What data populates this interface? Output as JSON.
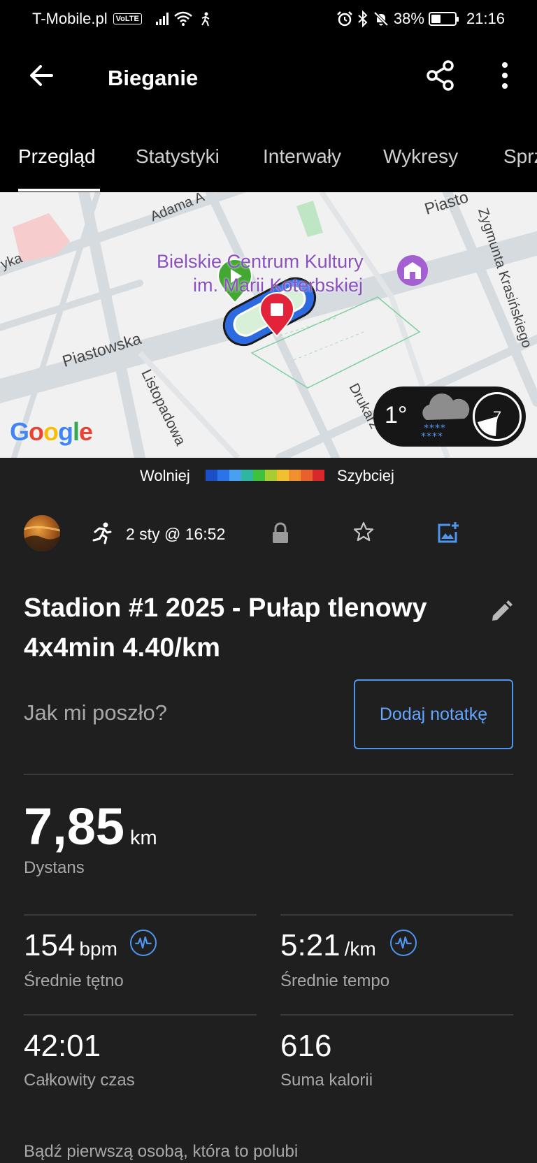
{
  "status_bar": {
    "carrier": "T-Mobile.pl",
    "volte": "VoLTE",
    "battery": "38%",
    "battery_level": 0.38,
    "time": "21:16"
  },
  "app_bar": {
    "title": "Bieganie",
    "back_icon": "arrow-left-icon",
    "share_icon": "share-icon",
    "more_icon": "more-vertical-icon"
  },
  "tabs": [
    "Przegląd",
    "Statystyki",
    "Interwały",
    "Wykresy",
    "Sprz"
  ],
  "active_tab": 0,
  "map": {
    "labels": {
      "poi": "Bielskie Centrum Kultury",
      "poi_2": "im. Marii Koterbskiej",
      "street_1": "Piastowska",
      "street_2": "Listopadowa",
      "street_3": "Adama A",
      "street_4": "Piasto",
      "street_5": "Zygmunta Krasińskiego",
      "street_6": "Drukarz",
      "street_7": "yka",
      "google": "Google"
    },
    "weather": {
      "temperature": "1°",
      "condition_icon": "snow-cloud-icon",
      "wind": "7"
    }
  },
  "legend": {
    "slow_label": "Wolniej",
    "fast_label": "Szybciej",
    "colors": [
      "#1a4fc8",
      "#2b73e8",
      "#4aa0f0",
      "#2eb6a0",
      "#3ec23e",
      "#a8cc32",
      "#f0c030",
      "#f29030",
      "#e8602c",
      "#d8282c"
    ]
  },
  "meta": {
    "activity_icon": "running-icon",
    "date": "2 sty @ 16:52",
    "privacy_icon": "lock-icon",
    "favorite_icon": "star-outline-icon",
    "add_photo_icon": "add-photo-icon"
  },
  "activity": {
    "title": "Stadion #1 2025 - Pułap tlenowy 4x4min 4.40/km",
    "notes_prompt": "Jak mi poszło?",
    "add_note_label": "Dodaj notatkę"
  },
  "stats": {
    "distance_value": "7,85",
    "distance_unit": "km",
    "distance_label": "Dystans",
    "hr_value": "154",
    "hr_unit": "bpm",
    "hr_label": "Średnie tętno",
    "pace_value": "5:21",
    "pace_unit": "/km",
    "pace_label": "Średnie tempo",
    "time_value": "42:01",
    "time_label": "Całkowity czas",
    "calories_value": "616",
    "calories_label": "Suma kalorii"
  },
  "social": {
    "like_prompt": "Bądź pierwszą osobą, która to polubi"
  },
  "colors": {
    "accent": "#4f95f0",
    "background": "#1f1f1f",
    "bar": "#000000"
  }
}
